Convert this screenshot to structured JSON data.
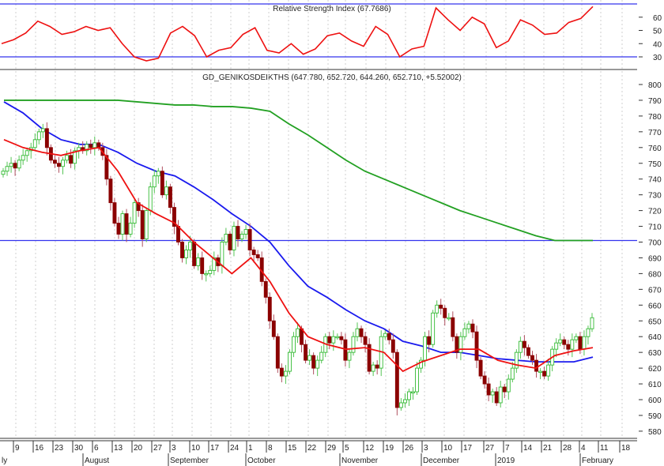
{
  "chart_data": {
    "type": "candlestick",
    "title": "GD_GENIKOSDEIKTHS (647.780, 652.720, 644.260, 652.710, +5.52002)",
    "rsi_title": "Relative Strength Index (67.7686)",
    "ylim": [
      575,
      805
    ],
    "yticks": [
      580,
      590,
      600,
      610,
      620,
      630,
      640,
      650,
      660,
      670,
      680,
      690,
      700,
      710,
      720,
      730,
      740,
      750,
      760,
      770,
      780,
      790,
      800
    ],
    "rsi_ylim": [
      20,
      71
    ],
    "rsi_yticks": [
      30,
      40,
      50,
      60
    ],
    "rsi_levels": [
      30,
      70
    ],
    "horizontal_line": 701,
    "date_ticks": [
      "9",
      "16",
      "23",
      "30",
      "6",
      "13",
      "20",
      "27",
      "3",
      "10",
      "17",
      "24",
      "1",
      "8",
      "15",
      "22",
      "29",
      "5",
      "12",
      "19",
      "26",
      "3",
      "10",
      "17",
      "27",
      "7",
      "14",
      "21",
      "28",
      "4",
      "11",
      "18"
    ],
    "month_labels": [
      "ly",
      "August",
      "September",
      "October",
      "November",
      "December",
      "2019",
      "February"
    ],
    "open_rule": "open = previous close",
    "close": [
      745,
      748,
      750,
      747,
      752,
      755,
      758,
      760,
      765,
      770,
      772,
      760,
      752,
      750,
      748,
      752,
      755,
      750,
      758,
      760,
      758,
      762,
      760,
      763,
      760,
      755,
      740,
      725,
      712,
      705,
      718,
      705,
      712,
      725,
      720,
      702,
      720,
      735,
      742,
      745,
      730,
      735,
      722,
      710,
      700,
      690,
      695,
      700,
      685,
      690,
      680,
      680,
      682,
      690,
      685,
      700,
      705,
      695,
      710,
      702,
      705,
      708,
      695,
      692,
      690,
      675,
      665,
      650,
      640,
      620,
      615,
      618,
      630,
      640,
      645,
      635,
      625,
      628,
      620,
      625,
      630,
      640,
      636,
      640,
      640,
      638,
      625,
      630,
      640,
      645,
      640,
      635,
      618,
      622,
      620,
      640,
      642,
      638,
      630,
      595,
      598,
      600,
      605,
      605,
      620,
      625,
      640,
      635,
      655,
      660,
      658,
      652,
      652,
      640,
      630,
      640,
      645,
      648,
      643,
      625,
      615,
      610,
      603,
      605,
      598,
      608,
      605,
      613,
      620,
      630,
      637,
      633,
      628,
      625,
      618,
      618,
      615,
      622,
      632,
      636,
      638,
      635,
      632,
      638,
      640,
      632,
      640,
      645,
      652
    ],
    "ma_short_red": [
      765,
      760,
      757,
      755,
      758,
      760,
      745,
      725,
      718,
      712,
      700,
      690,
      680,
      690,
      675,
      655,
      640,
      635,
      632,
      633,
      630,
      618,
      624,
      628,
      632,
      632,
      625,
      622,
      620,
      628,
      631,
      633
    ],
    "ma_mid_blue": [
      789,
      782,
      772,
      765,
      762,
      762,
      757,
      750,
      745,
      742,
      735,
      727,
      718,
      710,
      700,
      685,
      672,
      665,
      657,
      650,
      645,
      637,
      634,
      630,
      630,
      628,
      626,
      625,
      624,
      624,
      624,
      627
    ],
    "ma_long_green": [
      790,
      790,
      790,
      790,
      790,
      790,
      790,
      789,
      788,
      787,
      787,
      786,
      786,
      785,
      783,
      775,
      768,
      760,
      752,
      745,
      740,
      735,
      730,
      725,
      720,
      716,
      712,
      708,
      704,
      701,
      701,
      701
    ],
    "rsi": [
      40,
      43,
      48,
      57,
      53,
      47,
      49,
      53,
      50,
      52,
      40,
      30,
      27,
      29,
      48,
      53,
      46,
      30,
      35,
      37,
      47,
      52,
      35,
      33,
      40,
      32,
      36,
      46,
      48,
      42,
      38,
      53,
      47,
      30,
      36,
      38,
      67,
      58,
      50,
      60,
      55,
      37,
      42,
      58,
      54,
      47,
      48,
      56,
      59,
      68
    ]
  }
}
